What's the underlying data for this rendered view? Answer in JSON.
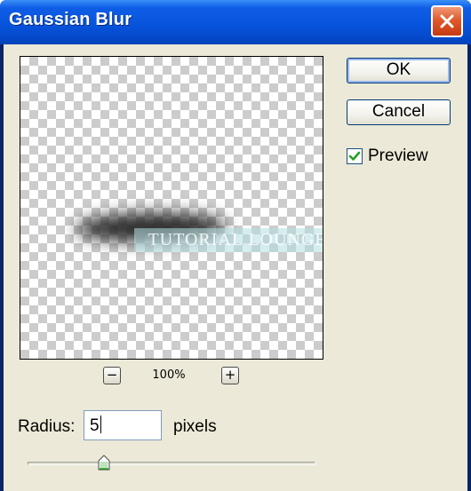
{
  "window": {
    "title": "Gaussian Blur",
    "close_icon": "close-icon"
  },
  "preview": {
    "watermark_text": "TUTORIAL LOUNGE",
    "zoom_out_label": "−",
    "zoom_in_label": "+",
    "zoom_level": "100%"
  },
  "buttons": {
    "ok_label": "OK",
    "cancel_label": "Cancel"
  },
  "options": {
    "preview_label": "Preview",
    "preview_checked": true
  },
  "radius": {
    "label": "Radius:",
    "value": "5",
    "unit": "pixels",
    "slider_fraction": 0.28
  },
  "colors": {
    "titlebar": "#0854dd",
    "dialog_bg": "#ece9d8",
    "checkmark": "#21a121",
    "close_button": "#e0592c"
  }
}
